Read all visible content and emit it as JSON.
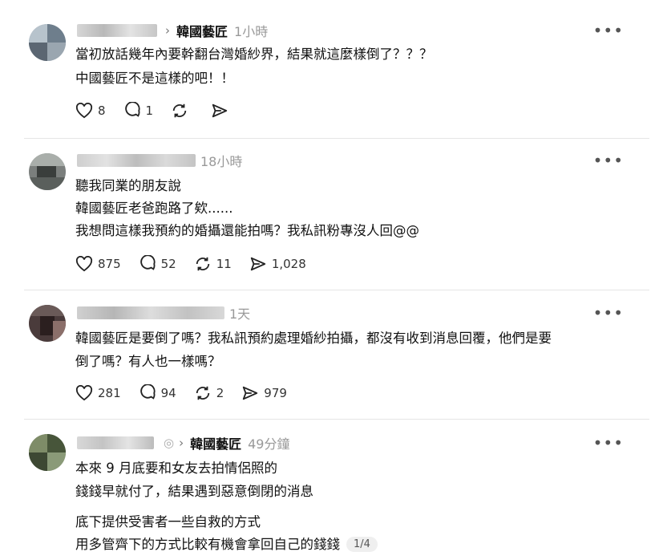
{
  "posts": [
    {
      "author_blurred": true,
      "thread": "韓國藝匠",
      "time": "1小時",
      "lines": [
        "當初放話幾年內要幹翻台灣婚紗界，結果就這麼樣倒了？？？",
        "中國藝匠不是這樣的吧！！"
      ],
      "likes": "8",
      "replies": "1",
      "reposts": "",
      "shares": ""
    },
    {
      "author_blurred": true,
      "thread": "",
      "time": "18小時",
      "lines": [
        "聽我同業的朋友說",
        "韓國藝匠老爸跑路了欸......",
        "我想問這樣我預約的婚攝還能拍嗎？我私訊粉專沒人回@@"
      ],
      "likes": "875",
      "replies": "52",
      "reposts": "11",
      "shares": "1,028"
    },
    {
      "author_blurred": true,
      "thread": "",
      "time": "1天",
      "lines": [
        "韓國藝匠是要倒了嗎？我私訊預約處理婚紗拍攝，都沒有收到消息回覆，他們是要",
        "倒了嗎？有人也一樣嗎？"
      ],
      "likes": "281",
      "replies": "94",
      "reposts": "2",
      "shares": "979"
    },
    {
      "author_blurred": true,
      "thread": "韓國藝匠",
      "time": "49分鐘",
      "lines": [
        "本來 9 月底要和女友去拍情侶照的",
        "錢錢早就付了，結果遇到惡意倒閉的消息",
        "底下提供受害者一些自救的方式",
        "用多管齊下的方式比較有機會拿回自己的錢錢"
      ],
      "page_indicator": "1/4"
    }
  ],
  "more_icon": "more-horizontal-icon",
  "colors": {
    "text": "#101010",
    "muted": "#999999",
    "divider": "#e5e5e5"
  }
}
